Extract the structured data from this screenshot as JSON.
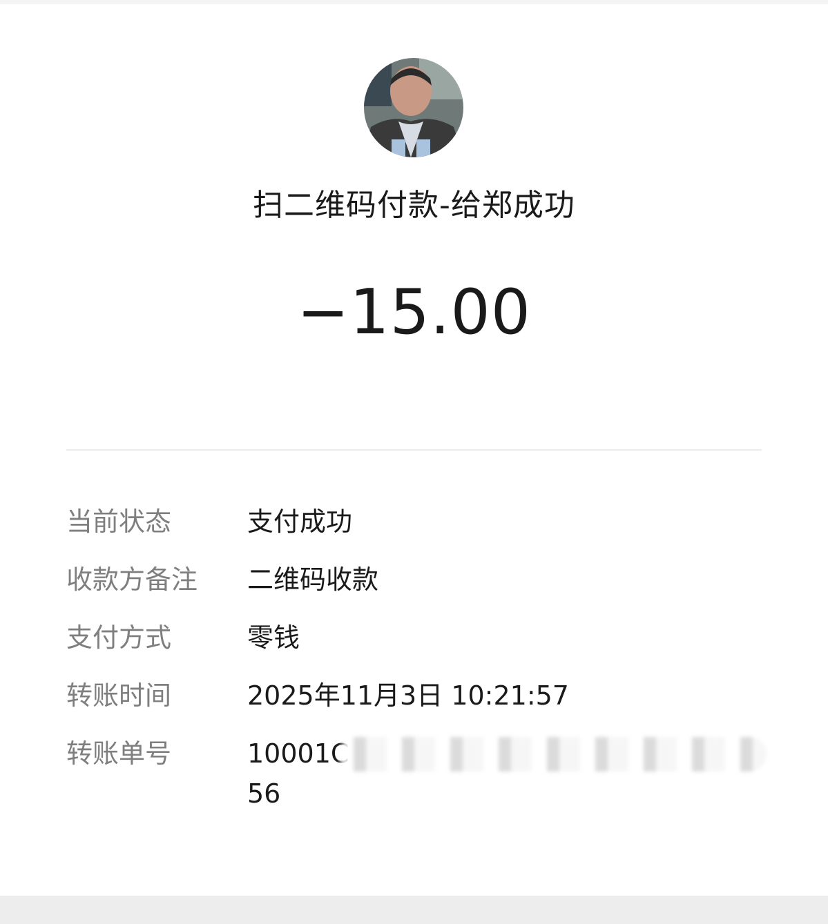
{
  "header": {
    "title": "扫二维码付款-给郑成功",
    "amount": "−15.00"
  },
  "details": [
    {
      "label": "当前状态",
      "value": "支付成功"
    },
    {
      "label": "收款方备注",
      "value": "二维码收款"
    },
    {
      "label": "支付方式",
      "value": "零钱"
    },
    {
      "label": "转账时间",
      "value": "2025年11月3日 10:21:57"
    },
    {
      "label": "转账单号",
      "value": "10001C",
      "value_line2": "56"
    }
  ]
}
